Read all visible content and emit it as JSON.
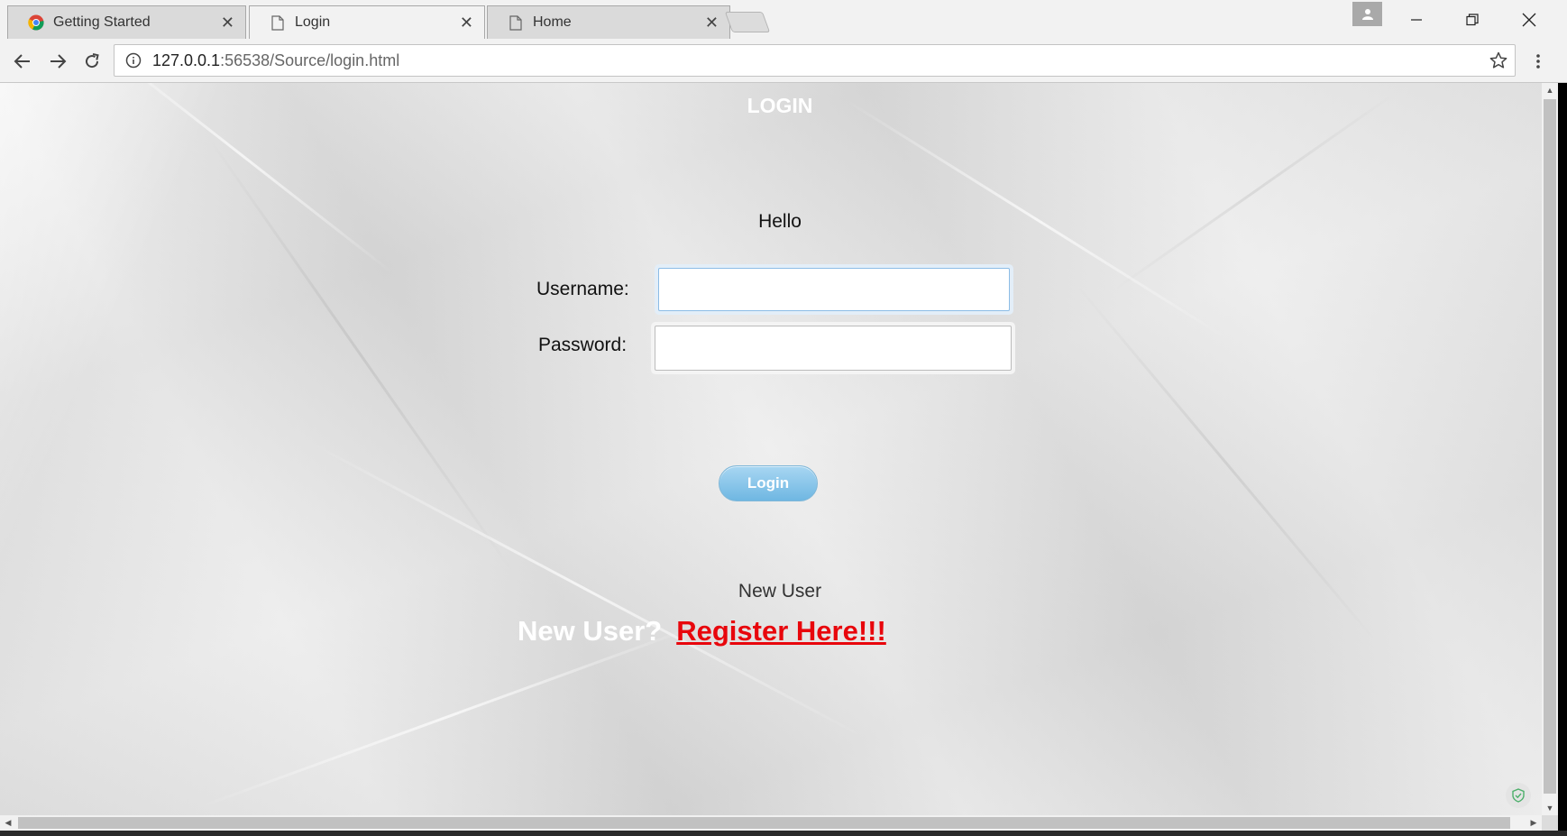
{
  "browser": {
    "tabs": [
      {
        "title": "Getting Started",
        "icon": "chrome-icon",
        "active": false
      },
      {
        "title": "Login",
        "icon": "page-icon",
        "active": true
      },
      {
        "title": "Home",
        "icon": "page-icon",
        "active": false
      }
    ],
    "tab_close_glyph": "✕",
    "url_host": "127.0.0.1",
    "url_rest": ":56538/Source/login.html"
  },
  "page": {
    "heading": "LOGIN",
    "greeting": "Hello",
    "username_label": "Username:",
    "username_value": "",
    "password_label": "Password:",
    "password_value": "",
    "login_button": "Login",
    "new_user_text": "New User",
    "register_prompt": "New User?",
    "register_link": "Register Here!!!"
  },
  "colors": {
    "register_link": "#e8060c",
    "login_button": "#6fb7e2",
    "heading": "#ffffff"
  }
}
